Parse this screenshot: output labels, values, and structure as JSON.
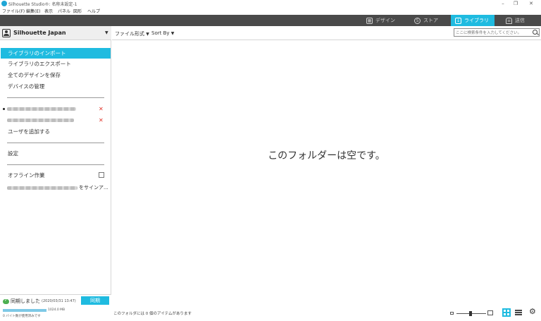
{
  "window": {
    "title": "Silhouette Studio®: 名称未設定-1",
    "minimize": "–",
    "maximize": "❐",
    "close": "✕"
  },
  "menubar": [
    "ファイル(F)",
    "編集(E)",
    "表示",
    "パネル",
    "図形",
    "ヘルプ"
  ],
  "nav": {
    "design": "デザイン",
    "store": "ストア",
    "library": "ライブラリ",
    "send": "送信",
    "active": "library"
  },
  "sidebar": {
    "account_name": "Silhouette Japan",
    "items": [
      "ライブラリのインポート",
      "ライブラリのエクスポート",
      "全てのデザインを保存",
      "デバイスの管理"
    ],
    "add_user": "ユーザを追加する",
    "settings": "設定",
    "offline": "オフライン作業",
    "offline_checked": false,
    "sign_in_suffix": "をサインア..."
  },
  "sync": {
    "status": "同期しました",
    "timestamp": "(2020/03/31 13:47)",
    "button": "同期",
    "capacity": "1024.0 MB",
    "used_text": "0 バイト数が使用済みです",
    "used_fraction": 0
  },
  "toolbar": {
    "file_type": "ファイル形式",
    "sort_by": "Sort By",
    "search_placeholder": "ここに検索条件を入力してください。"
  },
  "main": {
    "empty_message": "このフォルダーは空です。"
  },
  "status": {
    "item_count_text": "このフォルダには 0 個のアイテムがあります"
  },
  "colors": {
    "accent": "#1fbbe0",
    "nav_bg": "#4a4a4a",
    "remove": "#e0352b"
  }
}
